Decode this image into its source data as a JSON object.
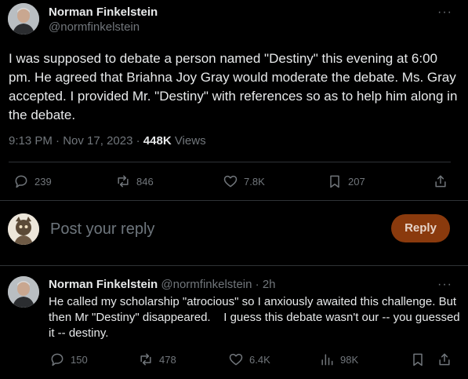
{
  "tweet": {
    "author_name": "Norman Finkelstein",
    "author_handle": "@normfinkelstein",
    "more": "···",
    "body": "I was supposed to debate a person named \"Destiny\" this evening at 6:00 pm.  He agreed that Briahna Joy Gray would moderate the debate.  Ms. Gray accepted.  I provided Mr. \"Destiny\" with references so as to help him along in the debate.",
    "time": "9:13 PM",
    "dot": "·",
    "date": "Nov 17, 2023",
    "views_count": "448K",
    "views_label": "Views",
    "actions": {
      "replies": "239",
      "reposts": "846",
      "likes": "7.8K",
      "bookmarks": "207"
    }
  },
  "composer": {
    "placeholder": "Post your reply",
    "button_label": "Reply"
  },
  "reply": {
    "author_name": "Norman Finkelstein",
    "author_handle": "@normfinkelstein",
    "time": "2h",
    "dot": "·",
    "more": "···",
    "body": "He called my scholarship \"atrocious\" so I anxiously awaited this challenge. But then Mr \"Destiny\" disappeared.    I guess this debate wasn't our -- you guessed it -- destiny.",
    "actions": {
      "replies": "150",
      "reposts": "478",
      "likes": "6.4K",
      "views": "98K"
    }
  },
  "icons": [
    "reply-icon",
    "repost-icon",
    "like-icon",
    "bookmark-icon",
    "share-icon",
    "views-icon",
    "more-icon"
  ],
  "colors": {
    "background": "#000000",
    "text": "#e7e9ea",
    "muted": "#71767b",
    "divider": "#2f3336",
    "reply_button": "#8a3a0d"
  }
}
